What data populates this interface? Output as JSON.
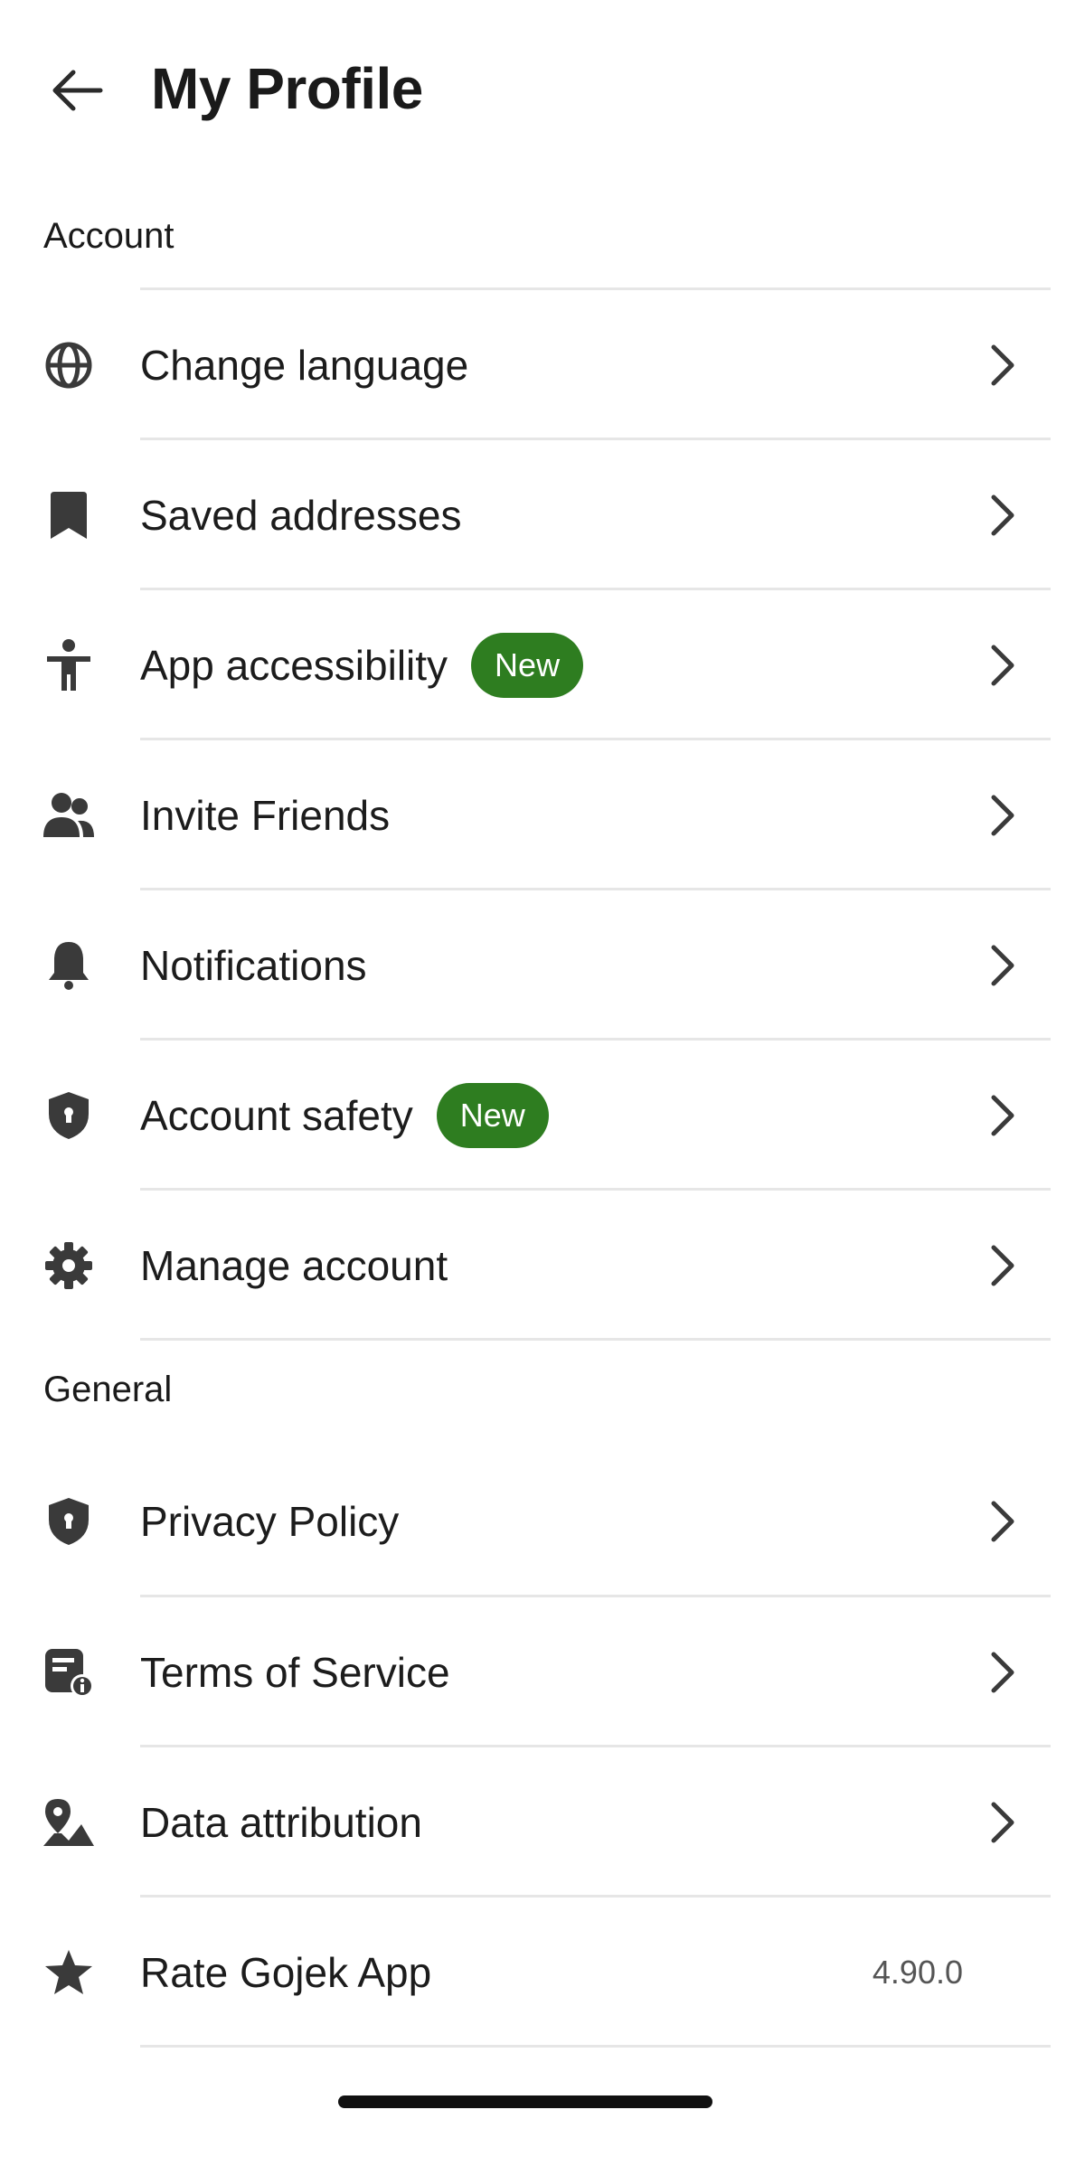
{
  "header": {
    "back_icon": "arrow-left-icon",
    "title": "My Profile"
  },
  "sections": {
    "account": {
      "label": "Account",
      "items": [
        {
          "icon": "globe-icon",
          "label": "Change language",
          "chevron": "chevron-right-icon"
        },
        {
          "icon": "bookmark-icon",
          "label": "Saved addresses",
          "chevron": "chevron-right-icon"
        },
        {
          "icon": "accessibility-icon",
          "label": "App accessibility",
          "badge": "New",
          "chevron": "chevron-right-icon"
        },
        {
          "icon": "people-icon",
          "label": "Invite Friends",
          "chevron": "chevron-right-icon"
        },
        {
          "icon": "bell-icon",
          "label": "Notifications",
          "chevron": "chevron-right-icon"
        },
        {
          "icon": "shield-icon",
          "label": "Account safety",
          "badge": "New",
          "chevron": "chevron-right-icon"
        },
        {
          "icon": "gear-icon",
          "label": "Manage account",
          "chevron": "chevron-right-icon"
        }
      ]
    },
    "general": {
      "label": "General",
      "items": [
        {
          "icon": "shield-icon",
          "label": "Privacy Policy",
          "chevron": "chevron-right-icon"
        },
        {
          "icon": "document-info-icon",
          "label": "Terms of Service",
          "chevron": "chevron-right-icon"
        },
        {
          "icon": "map-pin-icon",
          "label": "Data attribution",
          "chevron": "chevron-right-icon"
        },
        {
          "icon": "star-icon",
          "label": "Rate Gojek App",
          "value": "4.90.0"
        }
      ]
    }
  },
  "colors": {
    "badge_green": "#2e7d20",
    "icon_gray": "#3a3a3a",
    "divider": "#e6e6e6",
    "text": "#1c1c1c"
  }
}
